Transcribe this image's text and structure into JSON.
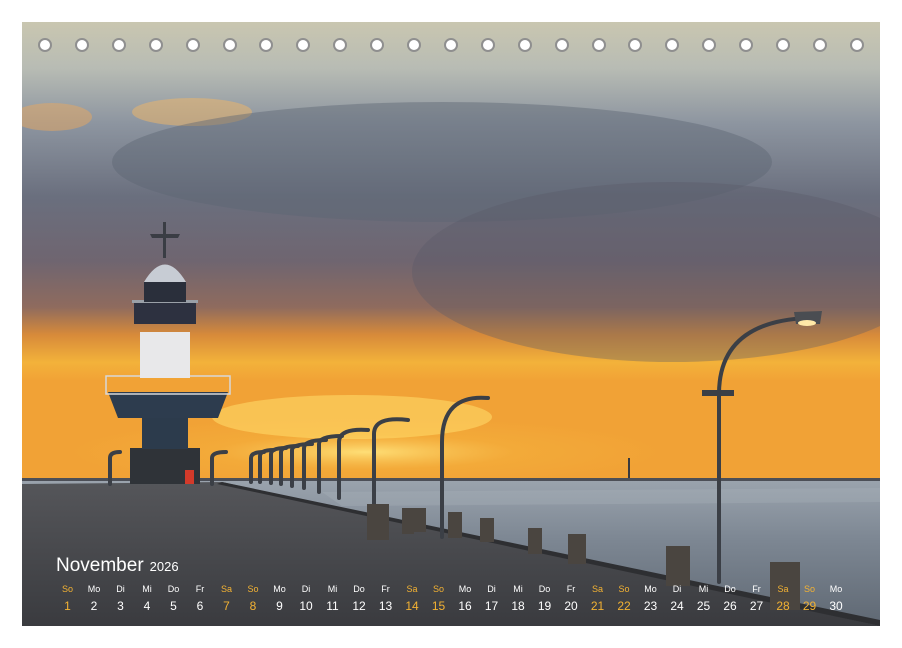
{
  "calendar": {
    "month": "November",
    "year": "2026",
    "weekend_color": "#f3b233",
    "days": [
      {
        "weekday": "So",
        "day": "1",
        "weekend": true
      },
      {
        "weekday": "Mo",
        "day": "2",
        "weekend": false
      },
      {
        "weekday": "Di",
        "day": "3",
        "weekend": false
      },
      {
        "weekday": "Mi",
        "day": "4",
        "weekend": false
      },
      {
        "weekday": "Do",
        "day": "5",
        "weekend": false
      },
      {
        "weekday": "Fr",
        "day": "6",
        "weekend": false
      },
      {
        "weekday": "Sa",
        "day": "7",
        "weekend": true
      },
      {
        "weekday": "So",
        "day": "8",
        "weekend": true
      },
      {
        "weekday": "Mo",
        "day": "9",
        "weekend": false
      },
      {
        "weekday": "Di",
        "day": "10",
        "weekend": false
      },
      {
        "weekday": "Mi",
        "day": "11",
        "weekend": false
      },
      {
        "weekday": "Do",
        "day": "12",
        "weekend": false
      },
      {
        "weekday": "Fr",
        "day": "13",
        "weekend": false
      },
      {
        "weekday": "Sa",
        "day": "14",
        "weekend": true
      },
      {
        "weekday": "So",
        "day": "15",
        "weekend": true
      },
      {
        "weekday": "Mo",
        "day": "16",
        "weekend": false
      },
      {
        "weekday": "Di",
        "day": "17",
        "weekend": false
      },
      {
        "weekday": "Mi",
        "day": "18",
        "weekend": false
      },
      {
        "weekday": "Do",
        "day": "19",
        "weekend": false
      },
      {
        "weekday": "Fr",
        "day": "20",
        "weekend": false
      },
      {
        "weekday": "Sa",
        "day": "21",
        "weekend": true
      },
      {
        "weekday": "So",
        "day": "22",
        "weekend": true
      },
      {
        "weekday": "Mo",
        "day": "23",
        "weekend": false
      },
      {
        "weekday": "Di",
        "day": "24",
        "weekend": false
      },
      {
        "weekday": "Mi",
        "day": "25",
        "weekend": false
      },
      {
        "weekday": "Do",
        "day": "26",
        "weekend": false
      },
      {
        "weekday": "Fr",
        "day": "27",
        "weekend": false
      },
      {
        "weekday": "Sa",
        "day": "28",
        "weekend": true
      },
      {
        "weekday": "So",
        "day": "29",
        "weekend": true
      },
      {
        "weekday": "Mo",
        "day": "30",
        "weekend": false
      }
    ]
  },
  "photo": {
    "subject": "lighthouse-pier-sunset"
  }
}
